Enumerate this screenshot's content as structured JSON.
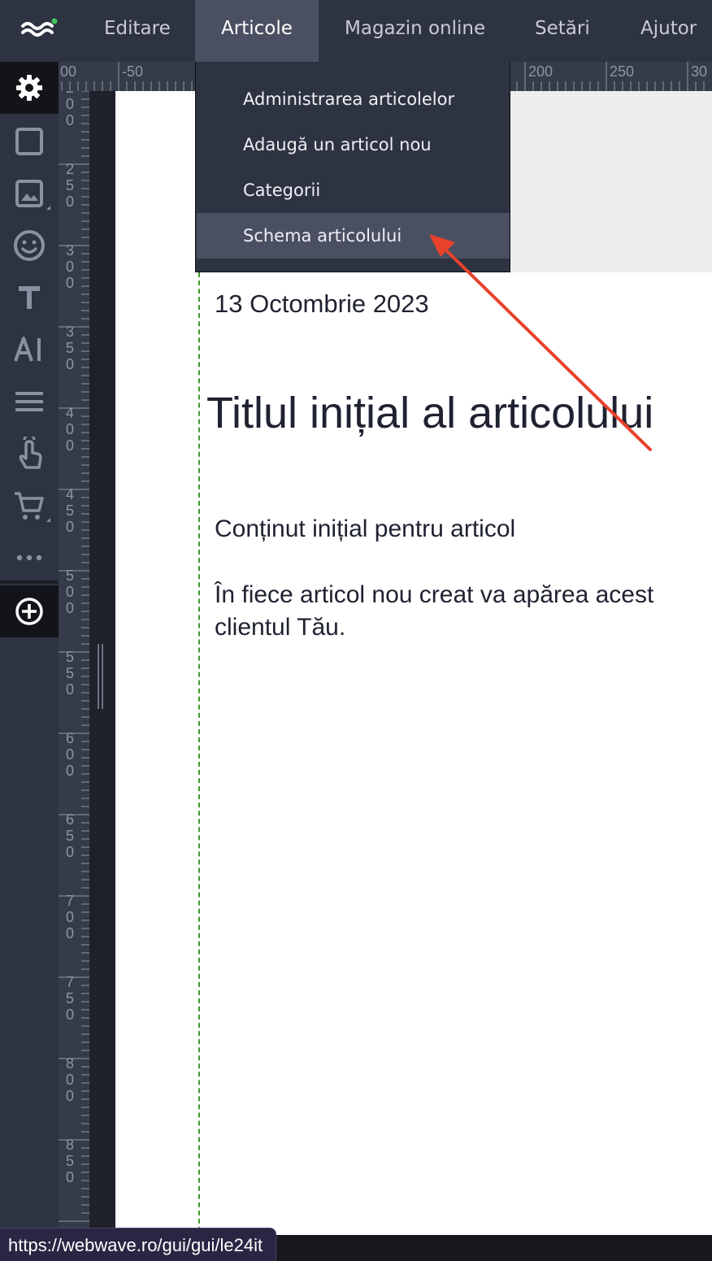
{
  "nav": {
    "items": [
      {
        "label": "Editare"
      },
      {
        "label": "Articole"
      },
      {
        "label": "Magazin online"
      },
      {
        "label": "Setări"
      },
      {
        "label": "Ajutor"
      }
    ],
    "active": "Articole"
  },
  "dropdown": {
    "items": [
      {
        "label": "Administrarea articolelor"
      },
      {
        "label": "Adaugă un articol nou"
      },
      {
        "label": "Categorii"
      },
      {
        "label": "Schema articolului"
      }
    ],
    "highlighted": "Schema articolului"
  },
  "sidebar": {
    "tools": [
      {
        "icon": "gear-icon"
      },
      {
        "icon": "square-shape-icon"
      },
      {
        "icon": "image-icon"
      },
      {
        "icon": "smiley-icon"
      },
      {
        "icon": "text-icon"
      },
      {
        "icon": "ai-icon"
      },
      {
        "icon": "menu-lines-icon"
      },
      {
        "icon": "touch-button-icon"
      },
      {
        "icon": "cart-icon"
      },
      {
        "icon": "more-icon"
      },
      {
        "icon": "add-circle-icon"
      }
    ]
  },
  "ruler": {
    "top_labels": [
      "00",
      "-50",
      "200",
      "250",
      "30"
    ],
    "left_labels": [
      "200",
      "250",
      "300",
      "350",
      "400",
      "450",
      "500",
      "550",
      "600",
      "650",
      "700",
      "750",
      "800",
      "850"
    ]
  },
  "article": {
    "date": "13 Octombrie 2023",
    "title": "Titlul inițial al articolului",
    "lead": "Conținut inițial pentru articol",
    "body_line1": "În fiece articol nou creat va apărea acest",
    "body_line2": "clientul Tău."
  },
  "status": {
    "url": "https://webwave.ro/gui/gui/le24it"
  },
  "colors": {
    "toolbar_bg": "#2e3342",
    "active_bg": "#4a5061",
    "annotation_arrow": "#e8412c",
    "guide_line": "#3f9a2e"
  }
}
